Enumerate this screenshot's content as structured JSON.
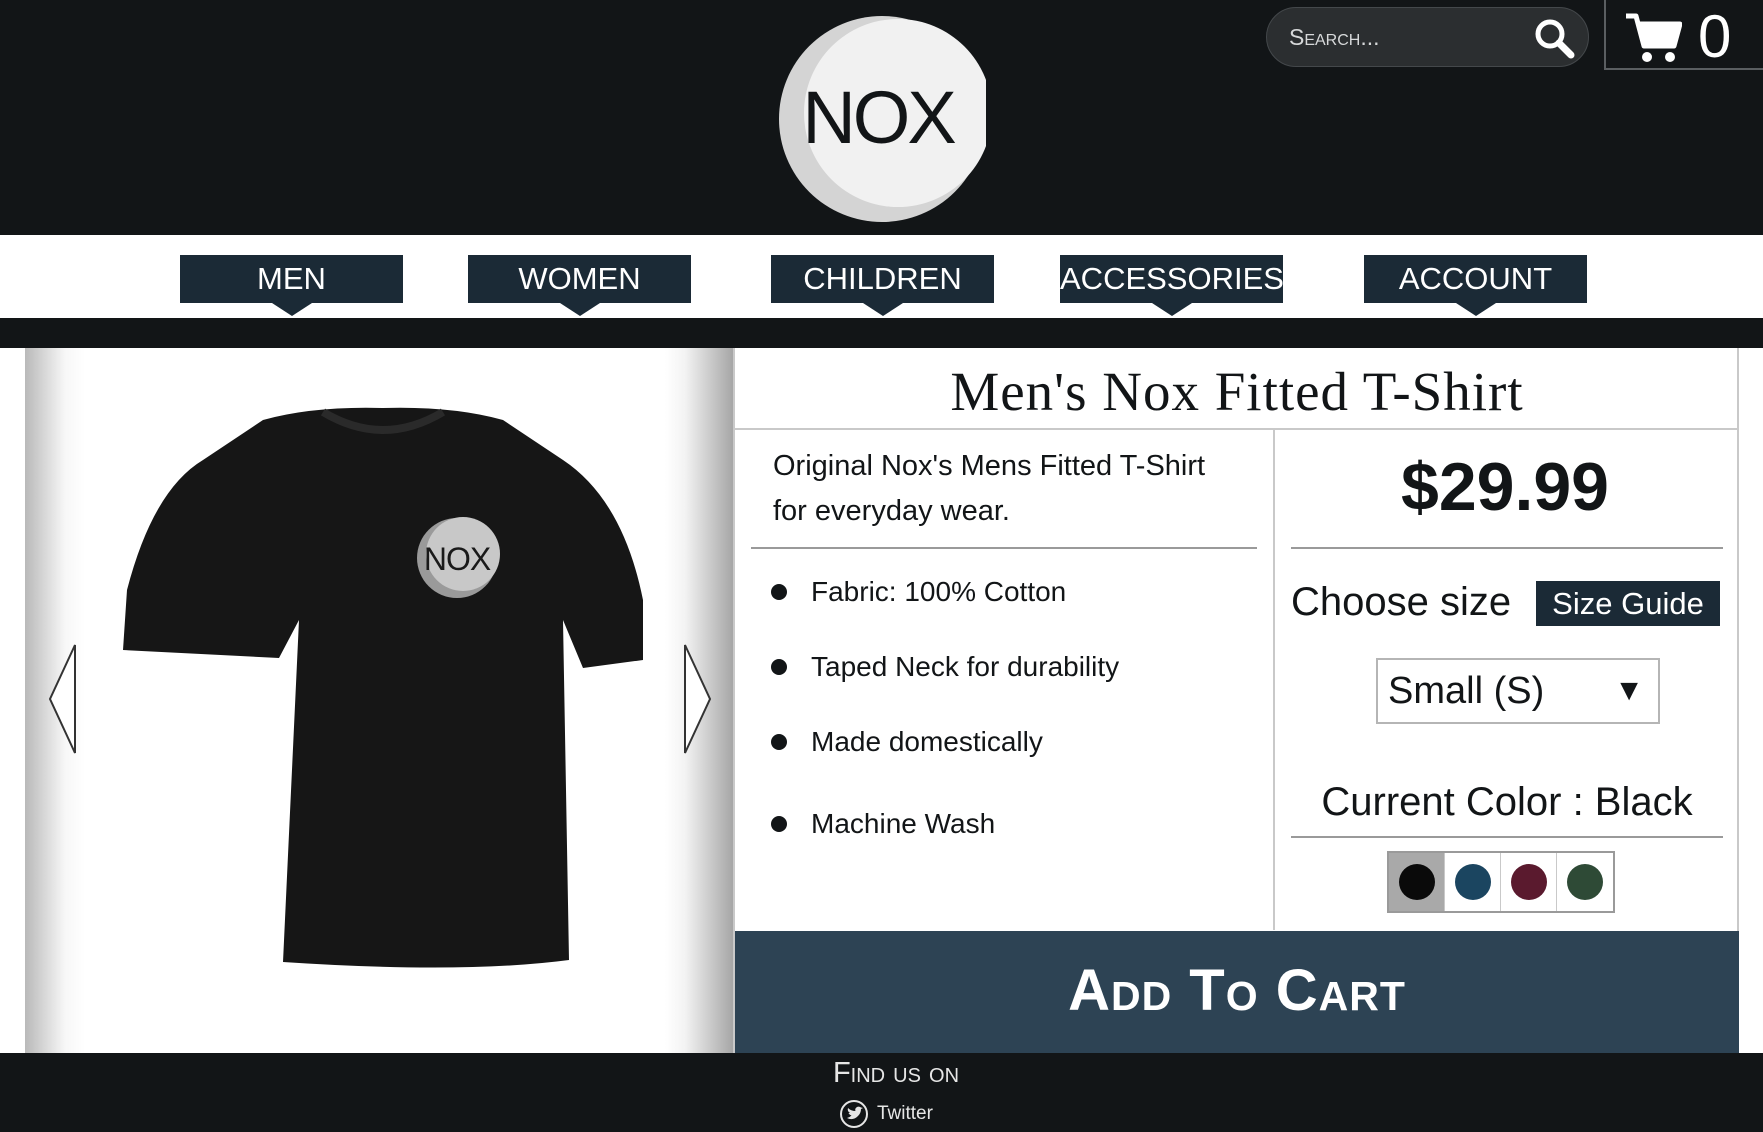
{
  "header": {
    "logo_text": "NOX",
    "search": {
      "placeholder": "Search..."
    },
    "cart": {
      "count": "0"
    }
  },
  "nav": {
    "items": [
      {
        "label": "MEN"
      },
      {
        "label": "WOMEN"
      },
      {
        "label": "CHILDREN"
      },
      {
        "label": "ACCESSORIES"
      },
      {
        "label": "ACCOUNT"
      }
    ]
  },
  "product": {
    "title": "Men's Nox Fitted T-Shirt",
    "description": "Original Nox's Mens Fitted T-Shirt for everyday wear.",
    "features": [
      "Fabric: 100% Cotton",
      "Taped Neck for durability",
      "Made domestically",
      "Machine Wash"
    ],
    "price": "$29.99",
    "choose_size_label": "Choose size",
    "size_guide_label": "Size Guide",
    "selected_size": "Small (S)",
    "current_color_label": "Current Color : Black",
    "colors": [
      {
        "name": "black",
        "hex": "#0a0a0a",
        "selected": true
      },
      {
        "name": "navy",
        "hex": "#1b4560",
        "selected": false
      },
      {
        "name": "maroon",
        "hex": "#5a1a2e",
        "selected": false
      },
      {
        "name": "dark-green",
        "hex": "#2e4a36",
        "selected": false
      }
    ],
    "shirt_logo_text": "NOX",
    "add_to_cart_label": "Add To Cart"
  },
  "footer": {
    "find_us": "Find us on",
    "social": [
      {
        "label": "Twitter",
        "icon": "twitter-icon"
      }
    ]
  },
  "theme": {
    "navy": "#1b2a36",
    "cta": "#2d4354",
    "background": "#121517"
  }
}
